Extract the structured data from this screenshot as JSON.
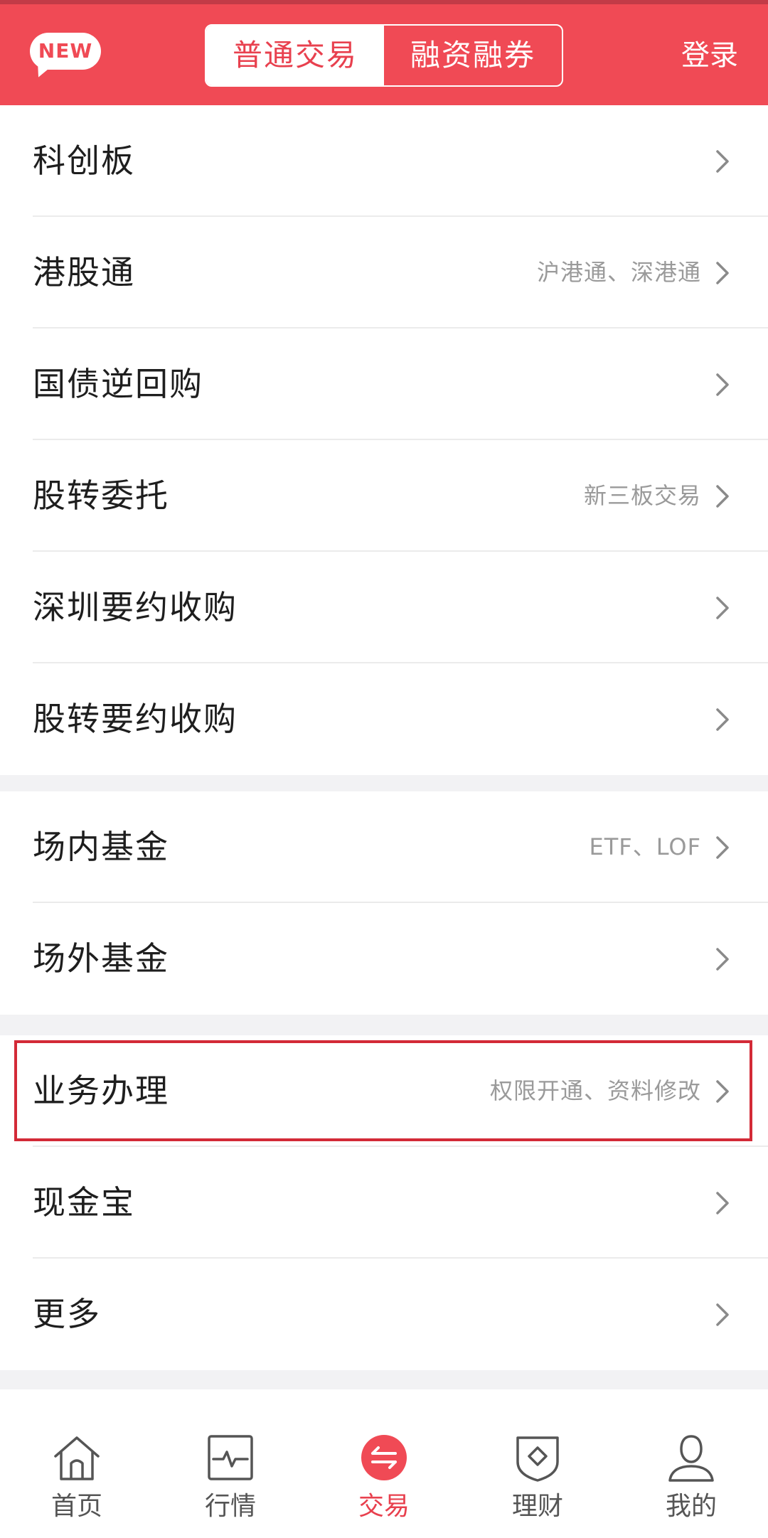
{
  "header": {
    "badge": "NEW",
    "segments": [
      {
        "label": "普通交易",
        "active": true
      },
      {
        "label": "融资融券",
        "active": false
      }
    ],
    "login": "登录"
  },
  "groups": [
    {
      "items": [
        {
          "label": "科创板",
          "hint": ""
        },
        {
          "label": "港股通",
          "hint": "沪港通、深港通"
        },
        {
          "label": "国债逆回购",
          "hint": ""
        },
        {
          "label": "股转委托",
          "hint": "新三板交易"
        },
        {
          "label": "深圳要约收购",
          "hint": ""
        },
        {
          "label": "股转要约收购",
          "hint": ""
        }
      ]
    },
    {
      "items": [
        {
          "label": "场内基金",
          "hint": "ETF、LOF"
        },
        {
          "label": "场外基金",
          "hint": ""
        }
      ]
    },
    {
      "items": [
        {
          "label": "业务办理",
          "hint": "权限开通、资料修改",
          "highlighted": true
        },
        {
          "label": "现金宝",
          "hint": ""
        },
        {
          "label": "更多",
          "hint": ""
        }
      ]
    }
  ],
  "tabbar": [
    {
      "label": "首页",
      "icon": "home-icon",
      "active": false
    },
    {
      "label": "行情",
      "icon": "pulse-chart-icon",
      "active": false
    },
    {
      "label": "交易",
      "icon": "exchange-arrows-icon",
      "active": true
    },
    {
      "label": "理财",
      "icon": "shield-diamond-icon",
      "active": false
    },
    {
      "label": "我的",
      "icon": "user-icon",
      "active": false
    }
  ],
  "colors": {
    "brand": "#f04a55",
    "highlight_border": "#d32a37",
    "text_primary": "#1e1e1e",
    "text_hint": "#9a9a9a",
    "tab_inactive": "#555555"
  }
}
